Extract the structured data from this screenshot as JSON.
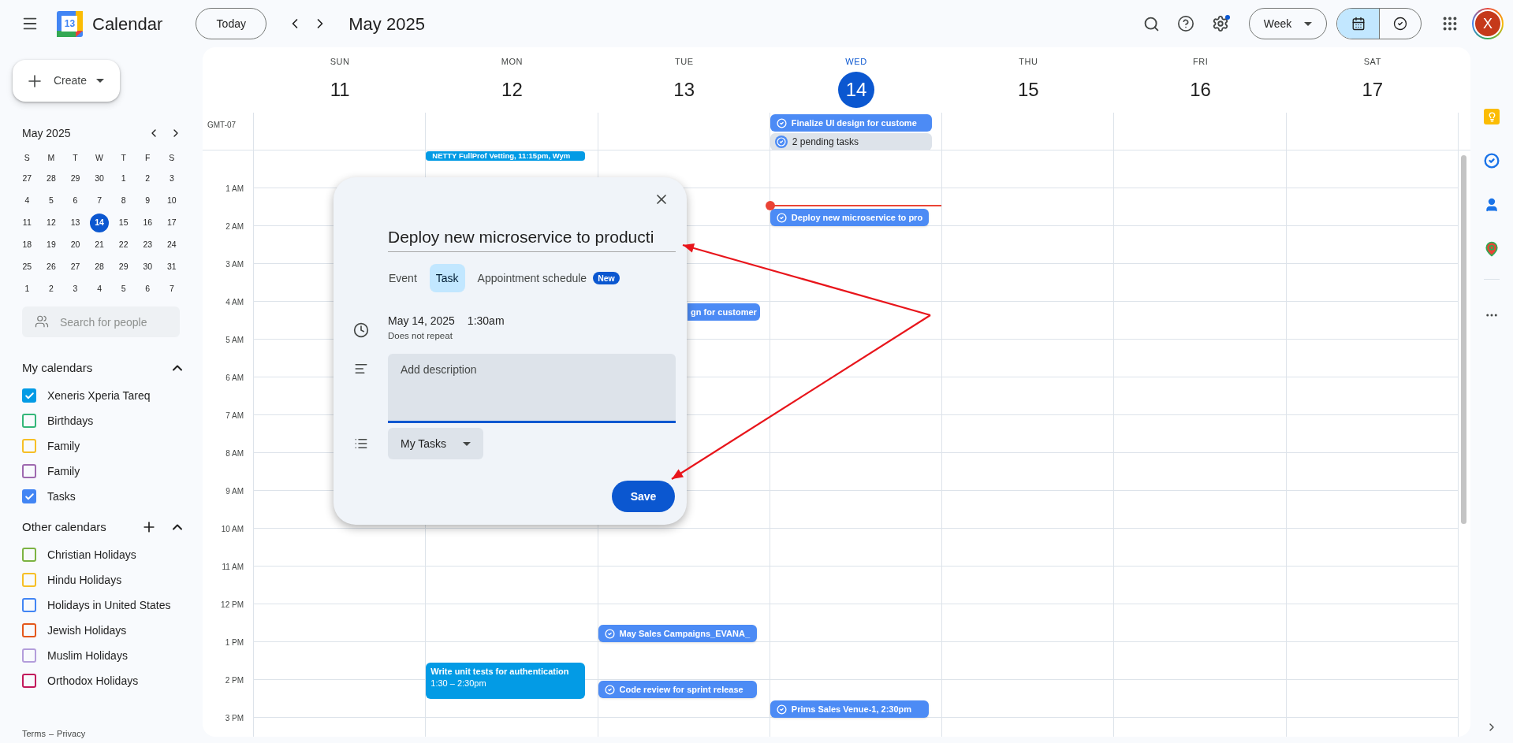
{
  "header": {
    "app_name": "Calendar",
    "logo_day": "13",
    "today_button": "Today",
    "period": "May 2025",
    "view_select": "Week",
    "views": [
      {
        "kind": "calendar",
        "selected": true
      },
      {
        "kind": "tasks",
        "selected": false
      }
    ],
    "avatar_initial": "X"
  },
  "sidebar": {
    "create": "Create",
    "mini_calendar": {
      "title": "May 2025",
      "weekdays": [
        "S",
        "M",
        "T",
        "W",
        "T",
        "F",
        "S"
      ],
      "weeks": [
        [
          {
            "day": "27",
            "selected": false
          },
          {
            "day": "28",
            "selected": false
          },
          {
            "day": "29",
            "selected": false
          },
          {
            "day": "30",
            "selected": false
          },
          {
            "day": "1",
            "selected": false
          },
          {
            "day": "2",
            "selected": false
          },
          {
            "day": "3",
            "selected": false
          }
        ],
        [
          {
            "day": "4",
            "selected": false
          },
          {
            "day": "5",
            "selected": false
          },
          {
            "day": "6",
            "selected": false
          },
          {
            "day": "7",
            "selected": false
          },
          {
            "day": "8",
            "selected": false
          },
          {
            "day": "9",
            "selected": false
          },
          {
            "day": "10",
            "selected": false
          }
        ],
        [
          {
            "day": "11",
            "selected": false
          },
          {
            "day": "12",
            "selected": false
          },
          {
            "day": "13",
            "selected": false
          },
          {
            "day": "14",
            "selected": true
          },
          {
            "day": "15",
            "selected": false
          },
          {
            "day": "16",
            "selected": false
          },
          {
            "day": "17",
            "selected": false
          }
        ],
        [
          {
            "day": "18",
            "selected": false
          },
          {
            "day": "19",
            "selected": false
          },
          {
            "day": "20",
            "selected": false
          },
          {
            "day": "21",
            "selected": false
          },
          {
            "day": "22",
            "selected": false
          },
          {
            "day": "23",
            "selected": false
          },
          {
            "day": "24",
            "selected": false
          }
        ],
        [
          {
            "day": "25",
            "selected": false
          },
          {
            "day": "26",
            "selected": false
          },
          {
            "day": "27",
            "selected": false
          },
          {
            "day": "28",
            "selected": false
          },
          {
            "day": "29",
            "selected": false
          },
          {
            "day": "30",
            "selected": false
          },
          {
            "day": "31",
            "selected": false
          }
        ],
        [
          {
            "day": "1",
            "selected": false
          },
          {
            "day": "2",
            "selected": false
          },
          {
            "day": "3",
            "selected": false
          },
          {
            "day": "4",
            "selected": false
          },
          {
            "day": "5",
            "selected": false
          },
          {
            "day": "6",
            "selected": false
          },
          {
            "day": "7",
            "selected": false
          }
        ]
      ]
    },
    "people_search": {
      "placeholder": "Search for people"
    },
    "my_calendars": {
      "title": "My calendars",
      "items": [
        {
          "label": "Xeneris Xperia Tareq",
          "checked": true,
          "color": "#039be5"
        },
        {
          "label": "Birthdays",
          "checked": false,
          "color": "#33b679"
        },
        {
          "label": "Family",
          "checked": false,
          "color": "#f6bf26"
        },
        {
          "label": "Family",
          "checked": false,
          "color": "#9e69af"
        },
        {
          "label": "Tasks",
          "checked": true,
          "color": "#4285f4"
        }
      ]
    },
    "other_calendars": {
      "title": "Other calendars",
      "items": [
        {
          "label": "Christian Holidays",
          "checked": false,
          "color": "#7cb342"
        },
        {
          "label": "Hindu Holidays",
          "checked": false,
          "color": "#f6bf26"
        },
        {
          "label": "Holidays in United States",
          "checked": false,
          "color": "#4285f4"
        },
        {
          "label": "Jewish Holidays",
          "checked": false,
          "color": "#e4571b"
        },
        {
          "label": "Muslim Holidays",
          "checked": false,
          "color": "#b39ddb"
        },
        {
          "label": "Orthodox Holidays",
          "checked": false,
          "color": "#c2185b"
        }
      ]
    },
    "footer": {
      "terms": "Terms",
      "separator": "–",
      "privacy": "Privacy"
    }
  },
  "week": {
    "timezone": "GMT-07",
    "hours": [
      "1 AM",
      "2 AM",
      "3 AM",
      "4 AM",
      "5 AM",
      "6 AM",
      "7 AM",
      "8 AM",
      "9 AM",
      "10 AM",
      "11 AM",
      "12 PM",
      "1 PM",
      "2 PM",
      "3 PM"
    ],
    "days": [
      {
        "name": "SUN",
        "date": "11",
        "selected": false,
        "now": false
      },
      {
        "name": "MON",
        "date": "12",
        "selected": false,
        "now": false,
        "events": [
          {
            "kind": "event",
            "title": "NETTY FullProf Vetting, 11:15pm, Wym",
            "color": "#039be5"
          },
          {
            "kind": "event",
            "title": "Write unit tests for authentication",
            "time": "1:30 – 2:30pm",
            "color": "#039be5"
          }
        ]
      },
      {
        "name": "TUE",
        "date": "13",
        "selected": false,
        "now": false,
        "events": [
          {
            "kind": "task_clipped",
            "title": "gn for customer",
            "color": "#4c8bf5"
          },
          {
            "kind": "task",
            "title": "May Sales Campaigns_EVANA_",
            "color": "#4c8bf5"
          },
          {
            "kind": "task",
            "title": "Code review for sprint release",
            "color": "#4c8bf5"
          }
        ]
      },
      {
        "name": "WED",
        "date": "14",
        "selected": true,
        "now": true,
        "all_day": [
          {
            "kind": "task",
            "title": "Finalize UI design for custome",
            "color": "#4c8bf5"
          },
          {
            "kind": "pending",
            "title": "2 pending tasks",
            "color": "#dde3ea"
          }
        ],
        "events": [
          {
            "kind": "task",
            "title": "Deploy new microservice to pro",
            "color": "#4c8bf5"
          },
          {
            "kind": "task",
            "title": "Prims Sales Venue-1, 2:30pm",
            "color": "#4c8bf5"
          }
        ]
      },
      {
        "name": "THU",
        "date": "15",
        "selected": false,
        "now": false
      },
      {
        "name": "FRI",
        "date": "16",
        "selected": false,
        "now": false
      },
      {
        "name": "SAT",
        "date": "17",
        "selected": false,
        "now": false
      }
    ]
  },
  "dialog": {
    "title_value": "Deploy new microservice to producti",
    "tabs": [
      {
        "label": "Event",
        "selected": false
      },
      {
        "label": "Task",
        "selected": true
      },
      {
        "label": "Appointment schedule",
        "selected": false,
        "badge": "New"
      }
    ],
    "date": "May 14, 2025",
    "time": "1:30am",
    "repeat": "Does not repeat",
    "description": {
      "placeholder": "Add description"
    },
    "list_select": "My Tasks",
    "save": "Save"
  }
}
